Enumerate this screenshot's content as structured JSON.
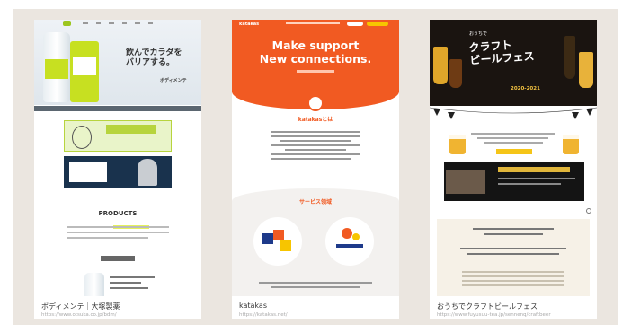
{
  "cards": [
    {
      "caption": "ボディメンテ｜大塚製薬",
      "url": "https://www.otsuka.co.jp/bdm/",
      "hero_tagline_1": "飲んでカラダを",
      "hero_tagline_2": "バリアする。",
      "hero_brand": "ボディメンテ",
      "section_title": "PRODUCTS"
    },
    {
      "caption": "katakas",
      "url": "https://katakas.net/",
      "logo": "katakas",
      "headline_1": "Make support",
      "headline_2": "New connections.",
      "about_title": "katakasとは",
      "service_title": "サービス領域"
    },
    {
      "caption": "おうちでクラフトビールフェス",
      "url": "https://www.fuyusuu-tea.jp/sennenq/craftbeer",
      "title_small": "おうちで",
      "title_1": "クラフト",
      "title_2": "ビール",
      "title_3": "フェス",
      "year": "2020-2021"
    }
  ],
  "colors": {
    "frame_bg": "#ebe6e0",
    "bodymaint_green": "#c7e021",
    "katakas_orange": "#f15a22",
    "beer_gold": "#f0b431"
  }
}
